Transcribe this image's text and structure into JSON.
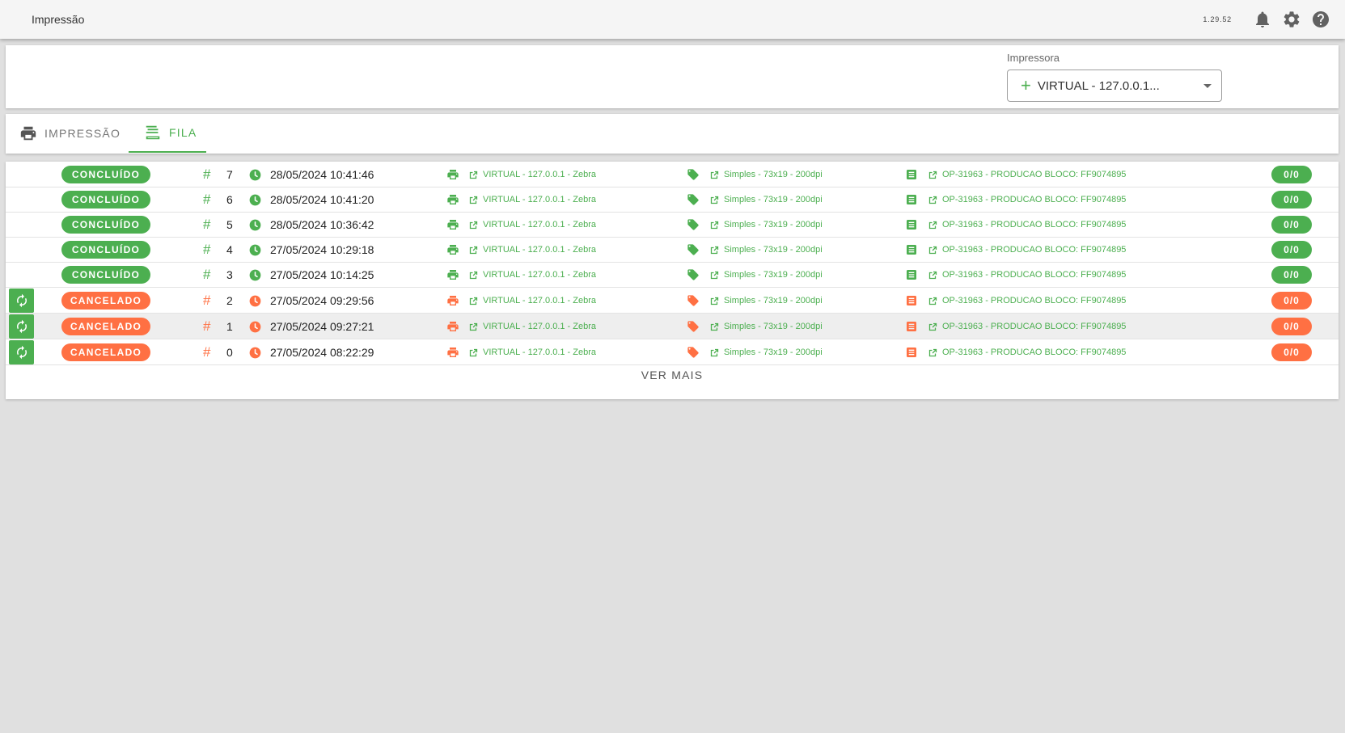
{
  "app": {
    "title": "Impressão",
    "version": "1.29.52",
    "icons": [
      "bell-icon",
      "gear-icon",
      "help-icon"
    ]
  },
  "printer": {
    "label": "Impressora",
    "selected": "VIRTUAL - 127.0.0.1..."
  },
  "tabs": [
    {
      "label": "IMPRESSÃO",
      "icon": "printer-icon",
      "active": false
    },
    {
      "label": "FILA",
      "icon": "queue-list-icon",
      "active": true
    }
  ],
  "colors": {
    "success": "#4caf50",
    "cancelled": "#ff7043"
  },
  "queue": {
    "rows": [
      {
        "status": "CONCLUÍDO",
        "type": "ok",
        "retry": false,
        "num": "7",
        "datetime": "28/05/2024 10:41:46",
        "printer": "VIRTUAL - 127.0.0.1 - Zebra",
        "label": "Simples - 73x19 - 200dpi",
        "document": "OP-31963 - PRODUCAO BLOCO: FF9074895",
        "count": "0/0"
      },
      {
        "status": "CONCLUÍDO",
        "type": "ok",
        "retry": false,
        "num": "6",
        "datetime": "28/05/2024 10:41:20",
        "printer": "VIRTUAL - 127.0.0.1 - Zebra",
        "label": "Simples - 73x19 - 200dpi",
        "document": "OP-31963 - PRODUCAO BLOCO: FF9074895",
        "count": "0/0"
      },
      {
        "status": "CONCLUÍDO",
        "type": "ok",
        "retry": false,
        "num": "5",
        "datetime": "28/05/2024 10:36:42",
        "printer": "VIRTUAL - 127.0.0.1 - Zebra",
        "label": "Simples - 73x19 - 200dpi",
        "document": "OP-31963 - PRODUCAO BLOCO: FF9074895",
        "count": "0/0"
      },
      {
        "status": "CONCLUÍDO",
        "type": "ok",
        "retry": false,
        "num": "4",
        "datetime": "27/05/2024 10:29:18",
        "printer": "VIRTUAL - 127.0.0.1 - Zebra",
        "label": "Simples - 73x19 - 200dpi",
        "document": "OP-31963 - PRODUCAO BLOCO: FF9074895",
        "count": "0/0"
      },
      {
        "status": "CONCLUÍDO",
        "type": "ok",
        "retry": false,
        "num": "3",
        "datetime": "27/05/2024 10:14:25",
        "printer": "VIRTUAL - 127.0.0.1 - Zebra",
        "label": "Simples - 73x19 - 200dpi",
        "document": "OP-31963 - PRODUCAO BLOCO: FF9074895",
        "count": "0/0"
      },
      {
        "status": "CANCELADO",
        "type": "cancel",
        "retry": true,
        "num": "2",
        "datetime": "27/05/2024 09:29:56",
        "printer": "VIRTUAL - 127.0.0.1 - Zebra",
        "label": "Simples - 73x19 - 200dpi",
        "document": "OP-31963 - PRODUCAO BLOCO: FF9074895",
        "count": "0/0"
      },
      {
        "status": "CANCELADO",
        "type": "cancel",
        "retry": true,
        "highlighted": true,
        "num": "1",
        "datetime": "27/05/2024 09:27:21",
        "printer": "VIRTUAL - 127.0.0.1 - Zebra",
        "label": "Simples - 73x19 - 200dpi",
        "document": "OP-31963 - PRODUCAO BLOCO: FF9074895",
        "count": "0/0"
      },
      {
        "status": "CANCELADO",
        "type": "cancel",
        "retry": true,
        "num": "0",
        "datetime": "27/05/2024 08:22:29",
        "printer": "VIRTUAL - 127.0.0.1 - Zebra",
        "label": "Simples - 73x19 - 200dpi",
        "document": "OP-31963 - PRODUCAO BLOCO: FF9074895",
        "count": "0/0"
      }
    ],
    "more_label": "VER MAIS"
  }
}
